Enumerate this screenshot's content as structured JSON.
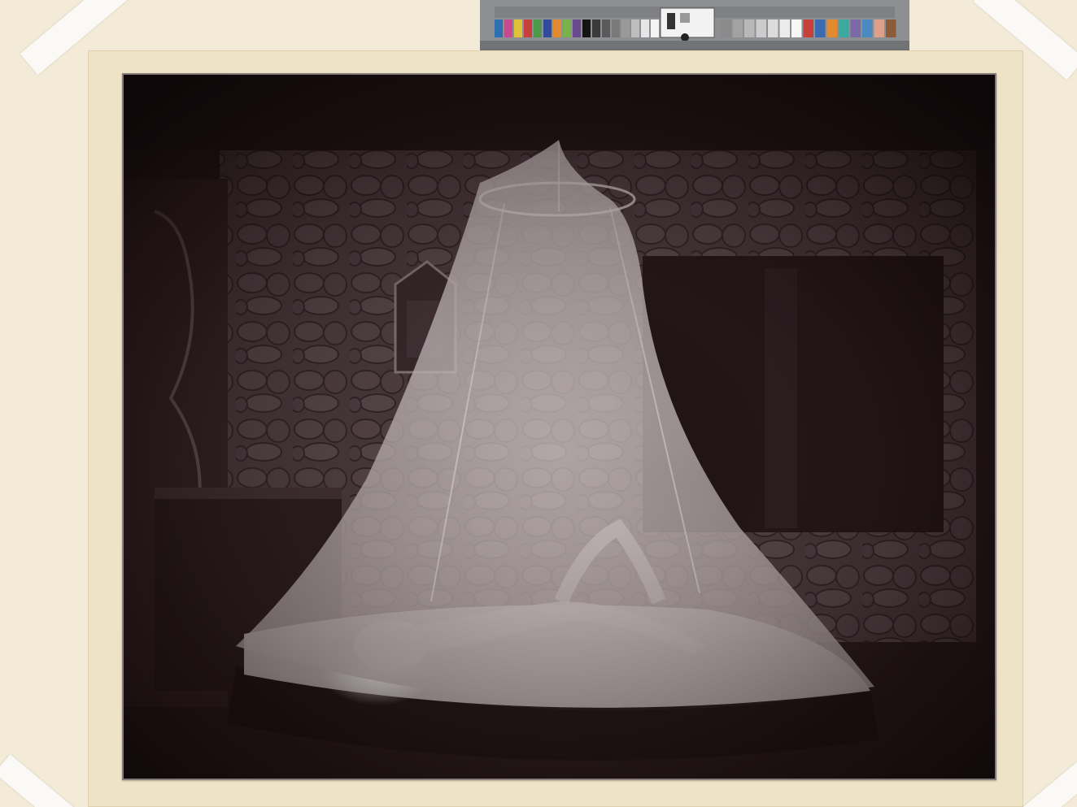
{
  "scene": {
    "subject": "mosquito-net-bed-photograph",
    "tones": {
      "board": "#f3ebd8",
      "mat": "#efe3c5",
      "photo_dark": "#1c1012",
      "wall": "#4a3a3e",
      "net": "#d8cfcf",
      "sheet": "#cfc6c6"
    }
  },
  "color_card": {
    "swatches": [
      "#2e6fb3",
      "#c64a8d",
      "#e0c23a",
      "#c8403c",
      "#4e9a4a",
      "#33499a",
      "#e28a2e",
      "#7ab24a",
      "#6a4a8e",
      "#141414",
      "#3a3a3a",
      "#5a5a5a",
      "#7a7a7a",
      "#9a9a9a",
      "#bdbdbd",
      "#e6e6e6",
      "#f4f4f4"
    ],
    "swatches_right": [
      "#8a8a8a",
      "#a2a2a2",
      "#b8b8b8",
      "#cccccc",
      "#dcdcdc",
      "#ececec",
      "#f6f6f6",
      "#c8403c",
      "#3c6ab0",
      "#e28a2e",
      "#3aaaa0",
      "#7a6aa8",
      "#4a8ac0",
      "#dea088",
      "#8a5a3a"
    ]
  }
}
